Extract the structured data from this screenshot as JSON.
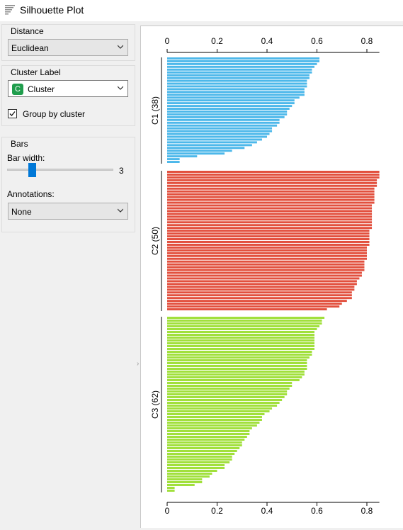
{
  "window": {
    "title": "Silhouette Plot"
  },
  "sidebar": {
    "distance": {
      "title": "Distance",
      "value": "Euclidean"
    },
    "cluster_label": {
      "title": "Cluster Label",
      "value": "Cluster",
      "icon_letter": "C",
      "group_by_label": "Group by cluster",
      "group_by_checked": true
    },
    "bars": {
      "title": "Bars",
      "bar_width_label": "Bar width:",
      "bar_width_value": "3",
      "annotations_label": "Annotations:",
      "annotations_value": "None"
    }
  },
  "chart_data": {
    "type": "bar",
    "orientation": "horizontal",
    "xlim": [
      0,
      0.85
    ],
    "x_ticks": [
      "0",
      "0.2",
      "0.4",
      "0.6",
      "0.8"
    ],
    "x_tick_values": [
      0,
      0.2,
      0.4,
      0.6,
      0.8
    ],
    "clusters": [
      {
        "label": "C1 (38)",
        "color": "#4db8ea",
        "values": [
          0.61,
          0.61,
          0.6,
          0.59,
          0.58,
          0.58,
          0.57,
          0.57,
          0.56,
          0.56,
          0.56,
          0.55,
          0.55,
          0.55,
          0.53,
          0.51,
          0.51,
          0.5,
          0.49,
          0.48,
          0.48,
          0.47,
          0.45,
          0.45,
          0.44,
          0.42,
          0.42,
          0.41,
          0.4,
          0.38,
          0.36,
          0.34,
          0.31,
          0.26,
          0.23,
          0.12,
          0.05,
          0.05
        ]
      },
      {
        "label": "C2 (50)",
        "color": "#e2503e",
        "values": [
          0.85,
          0.85,
          0.85,
          0.84,
          0.84,
          0.84,
          0.83,
          0.83,
          0.83,
          0.83,
          0.83,
          0.83,
          0.82,
          0.82,
          0.82,
          0.82,
          0.82,
          0.82,
          0.82,
          0.82,
          0.82,
          0.81,
          0.81,
          0.81,
          0.81,
          0.81,
          0.81,
          0.8,
          0.8,
          0.8,
          0.8,
          0.8,
          0.79,
          0.79,
          0.79,
          0.79,
          0.78,
          0.78,
          0.77,
          0.76,
          0.76,
          0.75,
          0.75,
          0.74,
          0.74,
          0.74,
          0.72,
          0.7,
          0.69,
          0.64
        ]
      },
      {
        "label": "C3 (62)",
        "color": "#a1e03c",
        "values": [
          0.63,
          0.62,
          0.62,
          0.61,
          0.6,
          0.59,
          0.59,
          0.59,
          0.59,
          0.59,
          0.59,
          0.59,
          0.58,
          0.58,
          0.57,
          0.56,
          0.56,
          0.56,
          0.56,
          0.55,
          0.55,
          0.54,
          0.53,
          0.5,
          0.5,
          0.49,
          0.48,
          0.48,
          0.47,
          0.46,
          0.45,
          0.44,
          0.42,
          0.41,
          0.39,
          0.38,
          0.38,
          0.37,
          0.36,
          0.34,
          0.33,
          0.33,
          0.32,
          0.31,
          0.3,
          0.3,
          0.29,
          0.28,
          0.27,
          0.26,
          0.26,
          0.25,
          0.23,
          0.23,
          0.2,
          0.18,
          0.17,
          0.14,
          0.14,
          0.11,
          0.03,
          0.03
        ]
      }
    ]
  }
}
